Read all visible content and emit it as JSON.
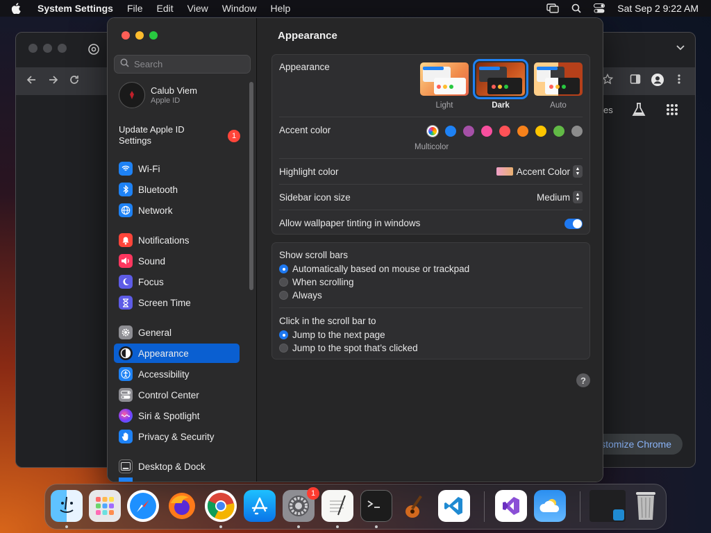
{
  "menubar": {
    "app_name": "System Settings",
    "menus": [
      "File",
      "Edit",
      "View",
      "Window",
      "Help"
    ],
    "clock": "Sat Sep 2  9:22 AM"
  },
  "chrome": {
    "customize_label": "ustomize Chrome",
    "cut_text": "es"
  },
  "sidebar": {
    "search_placeholder": "Search",
    "account_name": "Calub Viem",
    "account_sub": "Apple ID",
    "update_label": "Update Apple ID Settings",
    "update_badge": "1",
    "items": [
      {
        "label": "Wi-Fi",
        "icon": "wifi-icon",
        "color": "#1e82f5"
      },
      {
        "label": "Bluetooth",
        "icon": "bluetooth-icon",
        "color": "#1e82f5"
      },
      {
        "label": "Network",
        "icon": "globe-icon",
        "color": "#1e82f5"
      },
      {
        "label": "Notifications",
        "icon": "bell-icon",
        "color": "#ff453a"
      },
      {
        "label": "Sound",
        "icon": "speaker-icon",
        "color": "#ff375f"
      },
      {
        "label": "Focus",
        "icon": "moon-icon",
        "color": "#5e5ce6"
      },
      {
        "label": "Screen Time",
        "icon": "hourglass-icon",
        "color": "#5e5ce6"
      },
      {
        "label": "General",
        "icon": "gear-icon",
        "color": "#8e8e93"
      },
      {
        "label": "Appearance",
        "icon": "appearance-icon",
        "color": "#1c1c1e"
      },
      {
        "label": "Accessibility",
        "icon": "accessibility-icon",
        "color": "#1e82f5"
      },
      {
        "label": "Control Center",
        "icon": "control-center-icon",
        "color": "#8e8e93"
      },
      {
        "label": "Siri & Spotlight",
        "icon": "siri-icon",
        "color": "#b04ad6"
      },
      {
        "label": "Privacy & Security",
        "icon": "hand-icon",
        "color": "#1e82f5"
      },
      {
        "label": "Desktop & Dock",
        "icon": "dock-icon",
        "color": "#2c2c2e"
      }
    ],
    "selected_index": 8
  },
  "main": {
    "title": "Appearance",
    "appearance_label": "Appearance",
    "themes": [
      "Light",
      "Dark",
      "Auto"
    ],
    "selected_theme": "Dark",
    "accent_label": "Accent color",
    "accent_colors": [
      "multicolor",
      "#1e82f5",
      "#a550a7",
      "#f74f9e",
      "#ff5257",
      "#f7821b",
      "#ffc600",
      "#62ba46",
      "#8c8c8c"
    ],
    "accent_selected_name": "Multicolor",
    "highlight_label": "Highlight color",
    "highlight_value": "Accent Color",
    "sidebar_icon_label": "Sidebar icon size",
    "sidebar_icon_value": "Medium",
    "tinting_label": "Allow wallpaper tinting in windows",
    "tinting_on": true,
    "scroll_bars_title": "Show scroll bars",
    "scroll_bar_options": [
      "Automatically based on mouse or trackpad",
      "When scrolling",
      "Always"
    ],
    "scroll_bar_selected": 0,
    "click_title": "Click in the scroll bar to",
    "click_options": [
      "Jump to the next page",
      "Jump to the spot that’s clicked"
    ],
    "click_selected": 0,
    "help_label": "?"
  },
  "dock": {
    "apps": [
      "Finder",
      "Launchpad",
      "Safari",
      "Firefox",
      "Chrome",
      "App Store",
      "System Settings",
      "TextEdit",
      "Terminal",
      "GarageBand",
      "Visual Studio Code",
      "Visual Studio",
      "Weather"
    ],
    "settings_badge": "1"
  }
}
